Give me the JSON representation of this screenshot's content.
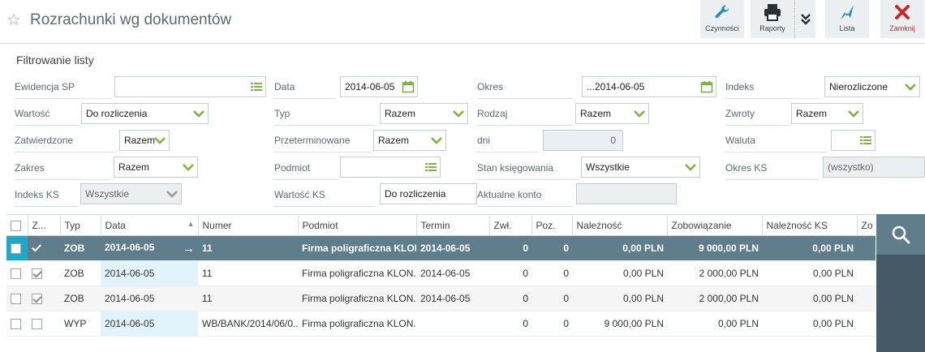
{
  "header": {
    "title": "Rozrachunki wg dokumentów",
    "buttons": {
      "czynnosci": "Czynności",
      "raporty": "Raporty",
      "lista": "Lista",
      "zamknij": "Zamknij"
    }
  },
  "filters": {
    "title": "Filtrowanie listy",
    "ewidencja_sp": {
      "label": "Ewidencja SP",
      "value": ""
    },
    "data": {
      "label": "Data",
      "value": "2014-06-05"
    },
    "okres": {
      "label": "Okres",
      "value": "...2014-06-05"
    },
    "indeks": {
      "label": "Indeks",
      "value": "Nierozliczone"
    },
    "wartosc": {
      "label": "Wartość",
      "value": "Do rozliczenia"
    },
    "typ": {
      "label": "Typ",
      "value": "Razem"
    },
    "rodzaj": {
      "label": "Rodzaj",
      "value": "Razem"
    },
    "zwroty": {
      "label": "Zwroty",
      "value": "Razem"
    },
    "zatwierdzone": {
      "label": "Zatwierdzone",
      "value": "Razem"
    },
    "przeterminowane": {
      "label": "Przeterminowane",
      "value": "Razem"
    },
    "dni": {
      "label": "dni",
      "value": "0"
    },
    "waluta": {
      "label": "Waluta",
      "value": ""
    },
    "zakres": {
      "label": "Zakres",
      "value": "Razem"
    },
    "podmiot": {
      "label": "Podmiot",
      "value": ""
    },
    "stan_ksiegowania": {
      "label": "Stan księgowania",
      "value": "Wszystkie"
    },
    "okres_ks": {
      "label": "Okres KS",
      "value": "(wszystko)"
    },
    "indeks_ks": {
      "label": "Indeks KS",
      "value": "Wszystkie"
    },
    "wartosc_ks": {
      "label": "Wartość KS",
      "value": "Do rozliczenia"
    },
    "aktualne_konto": {
      "label": "Aktualne konto",
      "value": ""
    }
  },
  "grid": {
    "columns": [
      "Z...",
      "Typ",
      "Data",
      "Numer",
      "Podmiot",
      "Termin",
      "Zwł.",
      "Poz.",
      "Należność",
      "Zobowiązanie",
      "Należność KS",
      "Zo"
    ],
    "rows": [
      {
        "checked": true,
        "typ": "ZOB",
        "data": "2014-06-05",
        "numer": "11",
        "podmiot": "Firma poligraficzna KLON...",
        "termin": "2014-06-05",
        "zwl": "0",
        "poz": "0",
        "naleznosc": "0,00 PLN",
        "zobowiazanie": "9 000,00 PLN",
        "naleznosc_ks": "0,00 PLN"
      },
      {
        "checked": true,
        "typ": "ZOB",
        "data": "2014-06-05",
        "numer": "11",
        "podmiot": "Firma poligraficzna KLON...",
        "termin": "2014-06-05",
        "zwl": "0",
        "poz": "0",
        "naleznosc": "0,00 PLN",
        "zobowiazanie": "2 000,00 PLN",
        "naleznosc_ks": "0,00 PLN"
      },
      {
        "checked": true,
        "typ": "ZOB",
        "data": "2014-06-05",
        "numer": "11",
        "podmiot": "Firma poligraficzna KLON...",
        "termin": "2014-06-05",
        "zwl": "0",
        "poz": "0",
        "naleznosc": "0,00 PLN",
        "zobowiazanie": "2 000,00 PLN",
        "naleznosc_ks": "0,00 PLN"
      },
      {
        "checked": false,
        "typ": "WYP",
        "data": "2014-06-05",
        "numer": "WB/BANK/2014/06/0...",
        "podmiot": "Firma poligraficzna KLON...",
        "termin": "",
        "zwl": "0",
        "poz": "0",
        "naleznosc": "9 000,00 PLN",
        "zobowiazanie": "0,00 PLN",
        "naleznosc_ks": "0,00 PLN"
      }
    ]
  },
  "colors": {
    "accent": "#1fa9c8",
    "selected_row": "#607d8b",
    "chevron": "#7cb342",
    "close": "#c62828"
  }
}
